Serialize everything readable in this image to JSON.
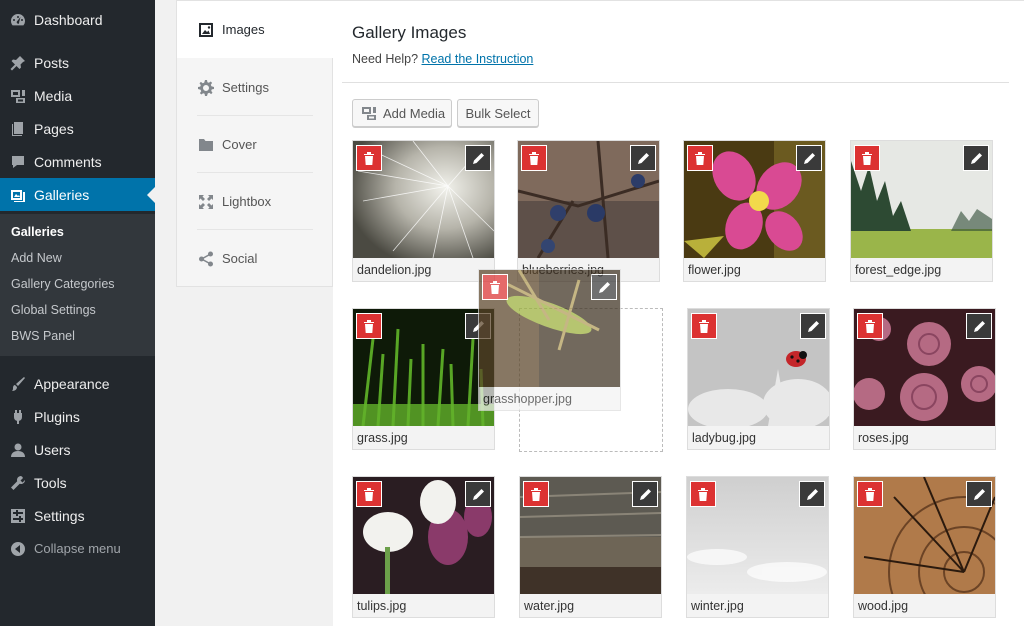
{
  "admin_menu": {
    "items": [
      {
        "label": "Dashboard",
        "icon": "dashboard-icon"
      },
      {
        "label": "Posts",
        "icon": "pin-icon"
      },
      {
        "label": "Media",
        "icon": "media-icon"
      },
      {
        "label": "Pages",
        "icon": "pages-icon"
      },
      {
        "label": "Comments",
        "icon": "comment-icon"
      },
      {
        "label": "Galleries",
        "icon": "gallery-icon"
      },
      {
        "label": "Appearance",
        "icon": "brush-icon"
      },
      {
        "label": "Plugins",
        "icon": "plugin-icon"
      },
      {
        "label": "Users",
        "icon": "user-icon"
      },
      {
        "label": "Tools",
        "icon": "wrench-icon"
      },
      {
        "label": "Settings",
        "icon": "settings-icon"
      },
      {
        "label": "Collapse menu",
        "icon": "collapse-icon"
      }
    ],
    "submenu": [
      "Galleries",
      "Add New",
      "Gallery Categories",
      "Global Settings",
      "BWS Panel"
    ]
  },
  "tabs": [
    {
      "label": "Images",
      "icon": "image-icon"
    },
    {
      "label": "Settings",
      "icon": "gear-icon"
    },
    {
      "label": "Cover",
      "icon": "folder-icon"
    },
    {
      "label": "Lightbox",
      "icon": "expand-icon"
    },
    {
      "label": "Social",
      "icon": "share-icon"
    }
  ],
  "main": {
    "title": "Gallery Images",
    "help_text": "Need Help?",
    "help_link": "Read the Instruction",
    "add_media_label": "Add Media",
    "bulk_select_label": "Bulk Select"
  },
  "gallery": [
    {
      "file": "dandelion.jpg"
    },
    {
      "file": "blueberries.jpg"
    },
    {
      "file": "flower.jpg"
    },
    {
      "file": "forest_edge.jpg"
    },
    {
      "file": "grass.jpg"
    },
    {
      "file": "grasshopper.jpg"
    },
    {
      "file": "ladybug.jpg"
    },
    {
      "file": "roses.jpg"
    },
    {
      "file": "tulips.jpg"
    },
    {
      "file": "water.jpg"
    },
    {
      "file": "winter.jpg"
    },
    {
      "file": "wood.jpg"
    }
  ],
  "colors": {
    "sidebar_bg": "#23282d",
    "sidebar_active": "#0073aa",
    "delete_red": "#dc3232",
    "link_blue": "#0073aa"
  }
}
